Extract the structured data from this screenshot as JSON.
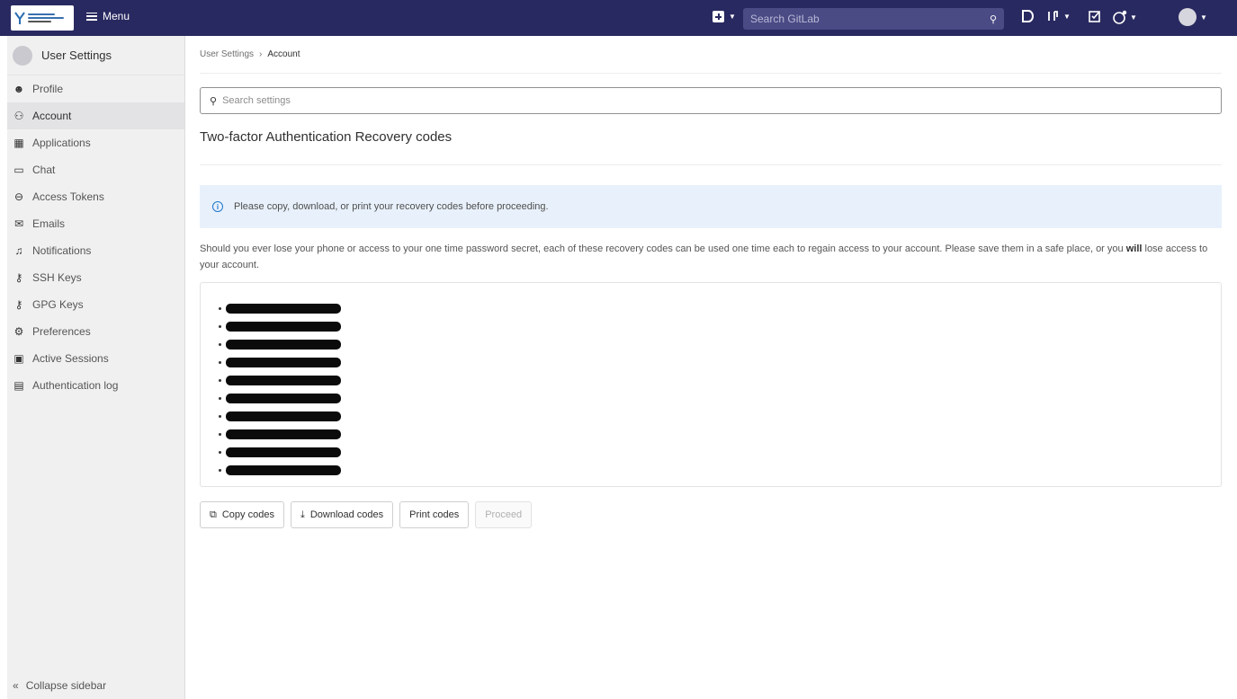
{
  "topbar": {
    "menu_label": "Menu",
    "search_placeholder": "Search GitLab",
    "icons": [
      "new-item-icon",
      "search-icon",
      "issues-icon",
      "merge-requests-icon",
      "todos-icon",
      "help-icon",
      "user-avatar"
    ]
  },
  "sidebar": {
    "title": "User Settings",
    "items": [
      {
        "label": "Profile",
        "icon": "profile-icon",
        "glyph": "☻"
      },
      {
        "label": "Account",
        "icon": "account-icon",
        "glyph": "⚇",
        "active": true
      },
      {
        "label": "Applications",
        "icon": "applications-icon",
        "glyph": "▦"
      },
      {
        "label": "Chat",
        "icon": "chat-icon",
        "glyph": "▭"
      },
      {
        "label": "Access Tokens",
        "icon": "token-icon",
        "glyph": "⊖"
      },
      {
        "label": "Emails",
        "icon": "email-icon",
        "glyph": "✉"
      },
      {
        "label": "Notifications",
        "icon": "bell-icon",
        "glyph": "♫"
      },
      {
        "label": "SSH Keys",
        "icon": "key-icon",
        "glyph": "⚷"
      },
      {
        "label": "GPG Keys",
        "icon": "key-icon",
        "glyph": "⚷"
      },
      {
        "label": "Preferences",
        "icon": "preferences-icon",
        "glyph": "⚙"
      },
      {
        "label": "Active Sessions",
        "icon": "monitor-icon",
        "glyph": "▣"
      },
      {
        "label": "Authentication log",
        "icon": "log-icon",
        "glyph": "▤"
      }
    ],
    "collapse_label": "Collapse sidebar"
  },
  "breadcrumb": {
    "parent": "User Settings",
    "current": "Account"
  },
  "search_settings": {
    "placeholder": "Search settings"
  },
  "page_title": "Two-factor Authentication Recovery codes",
  "alert_text": "Please copy, download, or print your recovery codes before proceeding.",
  "description": {
    "part1": "Should you ever lose your phone or access to your one time password secret, each of these recovery codes can be used one time each to regain access to your account. Please save them in a safe place, or you ",
    "bold": "will",
    "part2": " lose access to your account."
  },
  "recovery_codes_count": 10,
  "buttons": {
    "copy": "Copy codes",
    "download": "Download codes",
    "print": "Print codes",
    "proceed": "Proceed"
  }
}
